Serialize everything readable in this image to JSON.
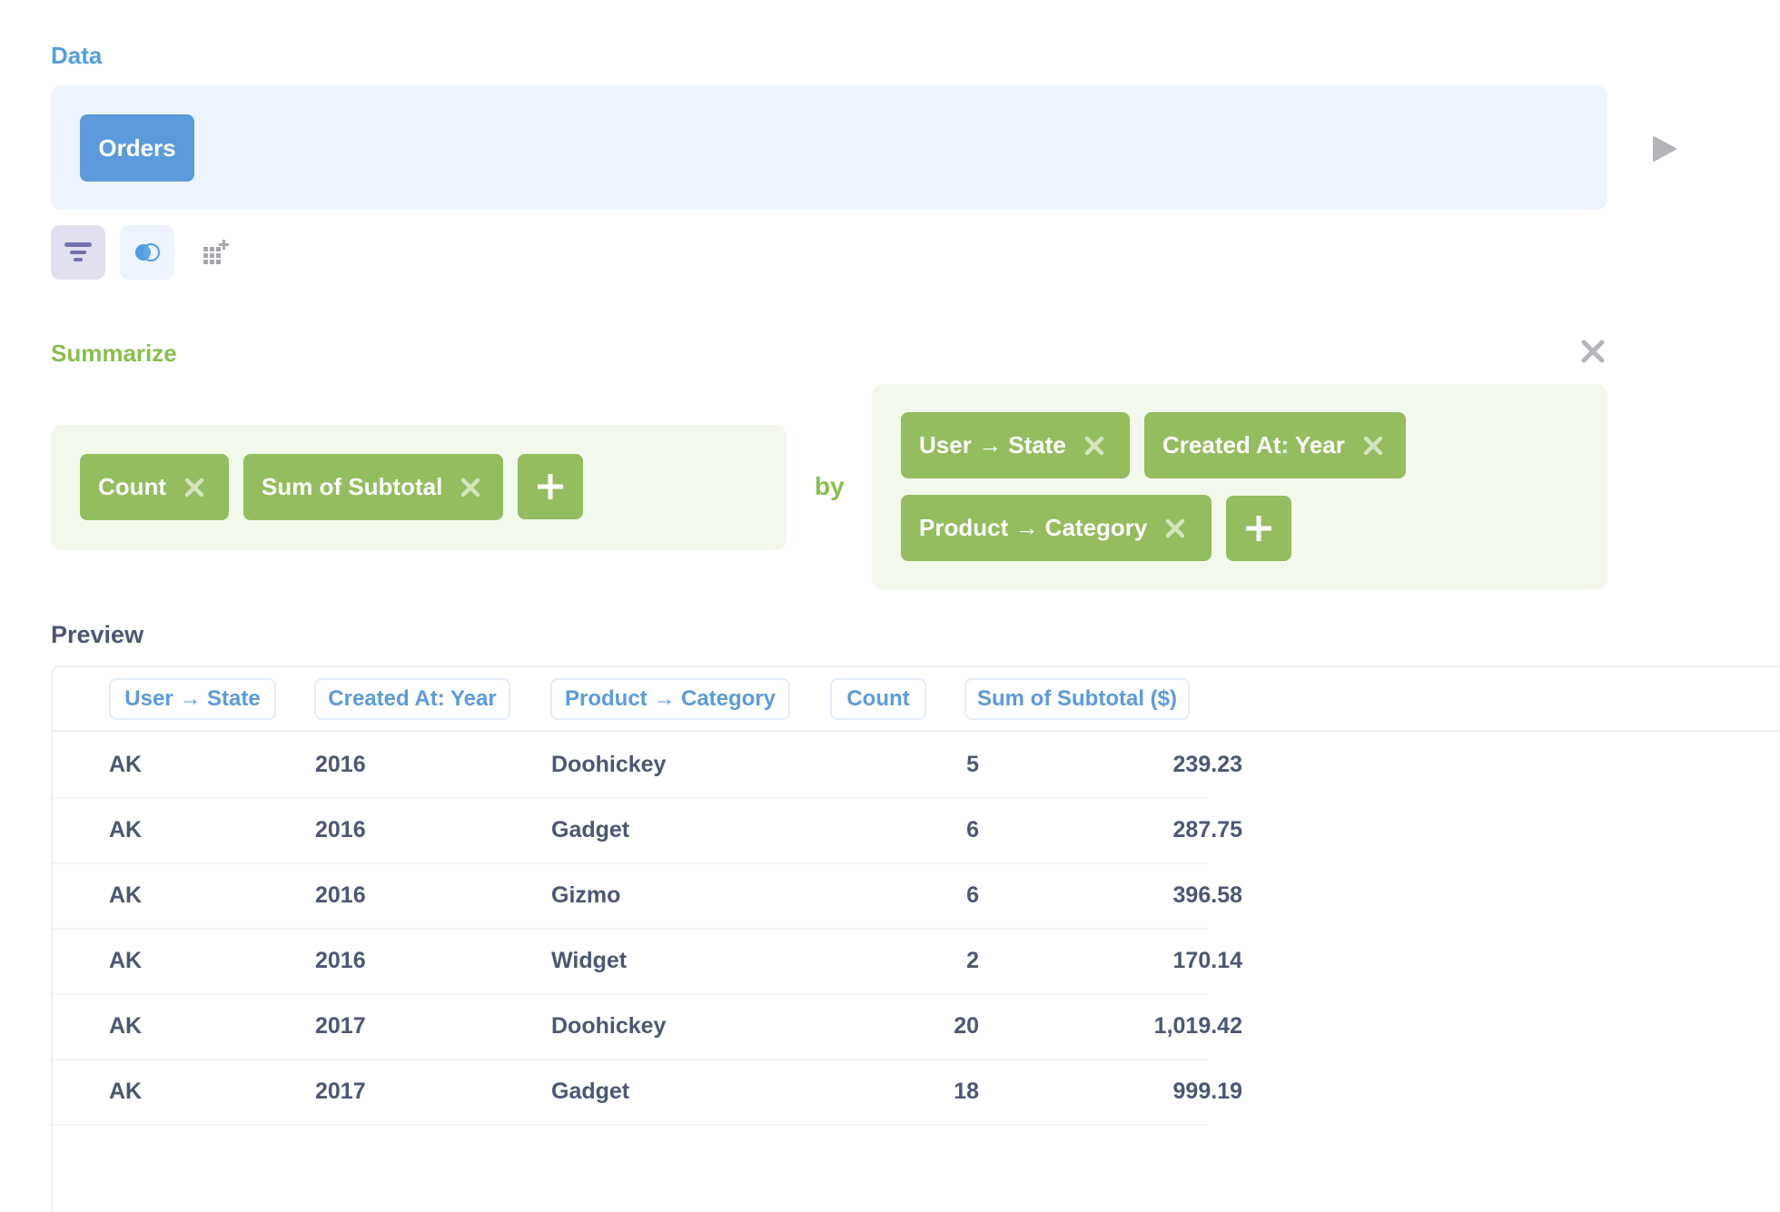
{
  "data_section": {
    "title": "Data",
    "source_table": "Orders",
    "run_icon": "play-icon",
    "tools": [
      {
        "name": "filter",
        "icon": "filter-icon"
      },
      {
        "name": "join",
        "icon": "join-icon"
      },
      {
        "name": "custom-column",
        "icon": "add-column-icon"
      }
    ]
  },
  "summarize_section": {
    "title": "Summarize",
    "remove_icon": "close-icon",
    "metrics": [
      {
        "label": "Count"
      },
      {
        "label": "Sum of Subtotal"
      }
    ],
    "by_label": "by",
    "breakouts": [
      {
        "label": "User → State"
      },
      {
        "label": "Created At: Year"
      },
      {
        "label": "Product → Category"
      }
    ]
  },
  "preview": {
    "title": "Preview",
    "columns": [
      "User → State",
      "Created At: Year",
      "Product → Category",
      "Count",
      "Sum of Subtotal ($)"
    ],
    "rows": [
      [
        "AK",
        "2016",
        "Doohickey",
        "5",
        "239.23"
      ],
      [
        "AK",
        "2016",
        "Gadget",
        "6",
        "287.75"
      ],
      [
        "AK",
        "2016",
        "Gizmo",
        "6",
        "396.58"
      ],
      [
        "AK",
        "2016",
        "Widget",
        "2",
        "170.14"
      ],
      [
        "AK",
        "2017",
        "Doohickey",
        "20",
        "1,019.42"
      ],
      [
        "AK",
        "2017",
        "Gadget",
        "18",
        "999.19"
      ]
    ]
  },
  "colors": {
    "data_accent": "#509ee3",
    "summarize_accent": "#88bf4d",
    "pill_green": "#93bd5e",
    "text_dark": "#4c5773"
  }
}
